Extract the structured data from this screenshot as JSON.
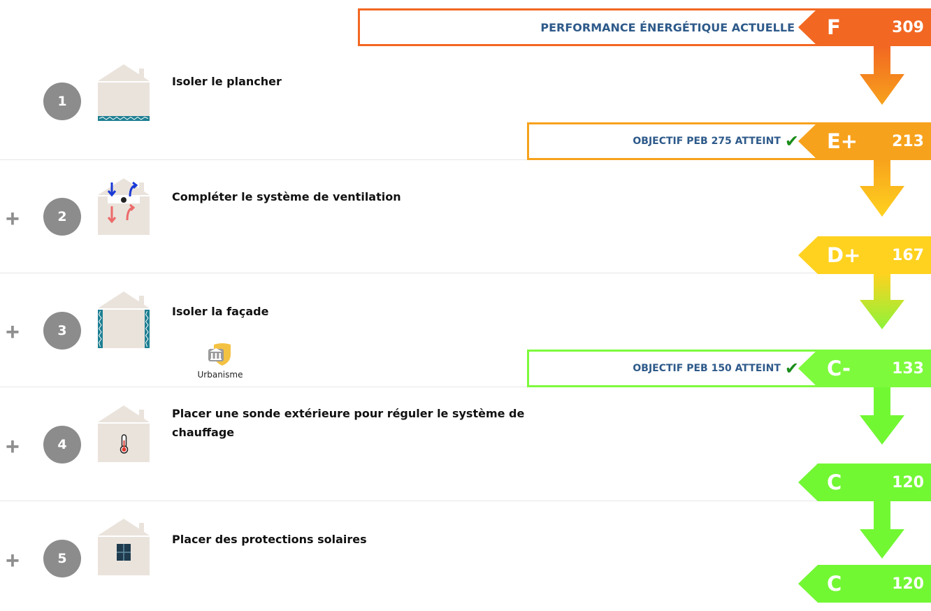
{
  "current": {
    "label": "PERFORMANCE ÉNERGÉTIQUE ACTUELLE",
    "letter": "F",
    "value": "309",
    "color": "#f26722"
  },
  "steps": [
    {
      "plus": "",
      "number": "1",
      "title": "Isoler le plancher",
      "icon": "house-floor-insulation-icon"
    },
    {
      "plus": "+",
      "number": "2",
      "title": "Compléter le système de ventilation",
      "icon": "house-ventilation-icon"
    },
    {
      "plus": "+",
      "number": "3",
      "title": "Isoler la façade",
      "icon": "house-facade-insulation-icon",
      "tag": {
        "icon": "urbanisme-shield-icon",
        "label": "Urbanisme"
      }
    },
    {
      "plus": "+",
      "number": "4",
      "title": "Placer une sonde extérieure pour réguler le système de chauffage",
      "icon": "house-thermometer-icon"
    },
    {
      "plus": "+",
      "number": "5",
      "title": "Placer des protections solaires",
      "icon": "house-window-icon"
    }
  ],
  "results": [
    {
      "letter": "E+",
      "value": "213",
      "color": "#f7a21c",
      "objective": "OBJECTIF PEB 275 ATTEINT",
      "check": "✔"
    },
    {
      "letter": "D+",
      "value": "167",
      "color": "#ffd21f",
      "objective": "",
      "check": ""
    },
    {
      "letter": "C-",
      "value": "133",
      "color": "#7dfa3c",
      "objective": "OBJECTIF PEB 150 ATTEINT",
      "check": "✔"
    },
    {
      "letter": "C",
      "value": "120",
      "color": "#72f733",
      "objective": "",
      "check": ""
    },
    {
      "letter": "C",
      "value": "120",
      "color": "#72f733",
      "objective": "",
      "check": ""
    }
  ]
}
